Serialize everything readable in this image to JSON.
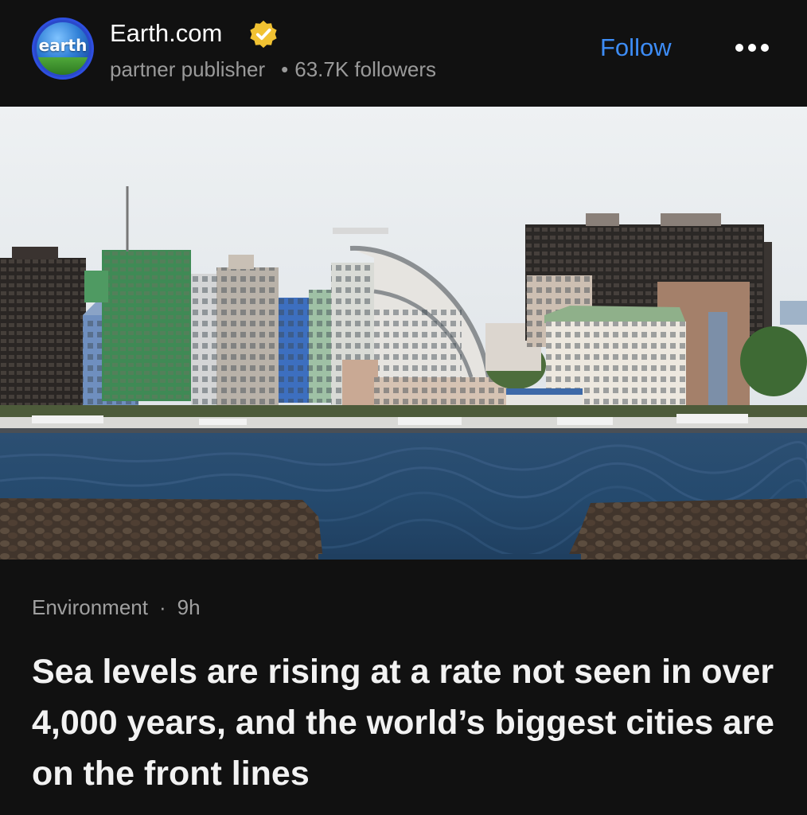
{
  "publisher": {
    "name": "Earth.com",
    "avatar_text": "earth",
    "subtitle_label": "partner publisher",
    "separator": "•",
    "followers": "63.7K followers",
    "verified_icon": "verified-badge-icon",
    "follow_label": "Follow",
    "more_icon": "more-options-icon"
  },
  "article": {
    "category": "Environment",
    "separator": "·",
    "age": "9h",
    "headline": "Sea levels are rising at a rate not seen in over 4,000 years, and the world’s biggest cities are on the front lines"
  },
  "colors": {
    "background": "#111111",
    "follow_link": "#3d8cf5",
    "verified_badge": "#f1c232",
    "secondary_text": "#9a9a9a"
  }
}
